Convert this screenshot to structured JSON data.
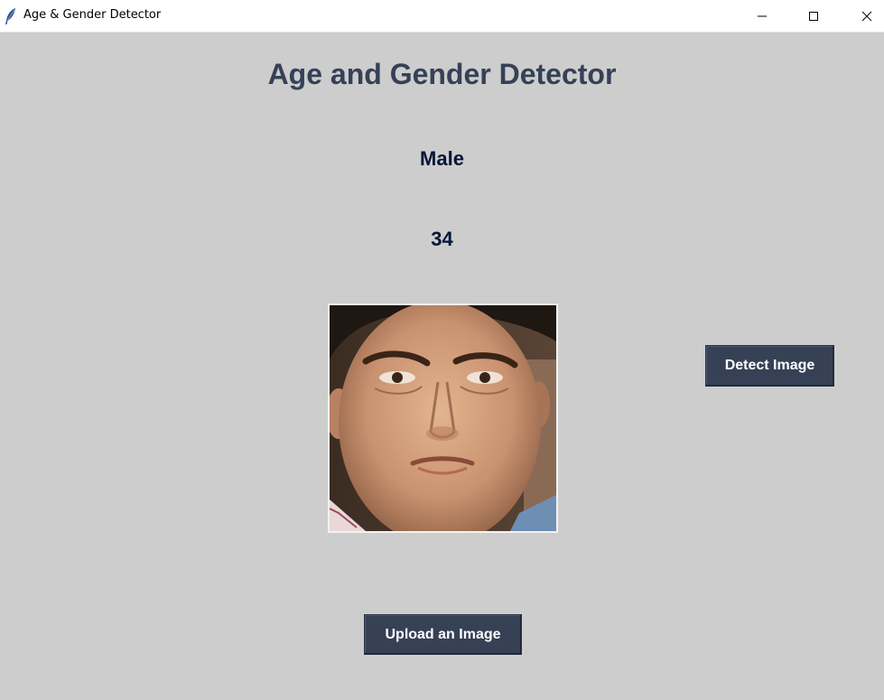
{
  "window": {
    "title": "Age & Gender Detector",
    "icon": "feather-icon"
  },
  "main": {
    "heading": "Age and Gender Detector",
    "gender": "Male",
    "age": "34",
    "photo_description_icon": "face-photo"
  },
  "buttons": {
    "detect_label": "Detect Image",
    "upload_label": "Upload an Image"
  },
  "colors": {
    "background": "#cdcdcd",
    "heading": "#364156",
    "result_text": "#011638",
    "button_bg": "#364156",
    "button_text": "#ffffff"
  }
}
